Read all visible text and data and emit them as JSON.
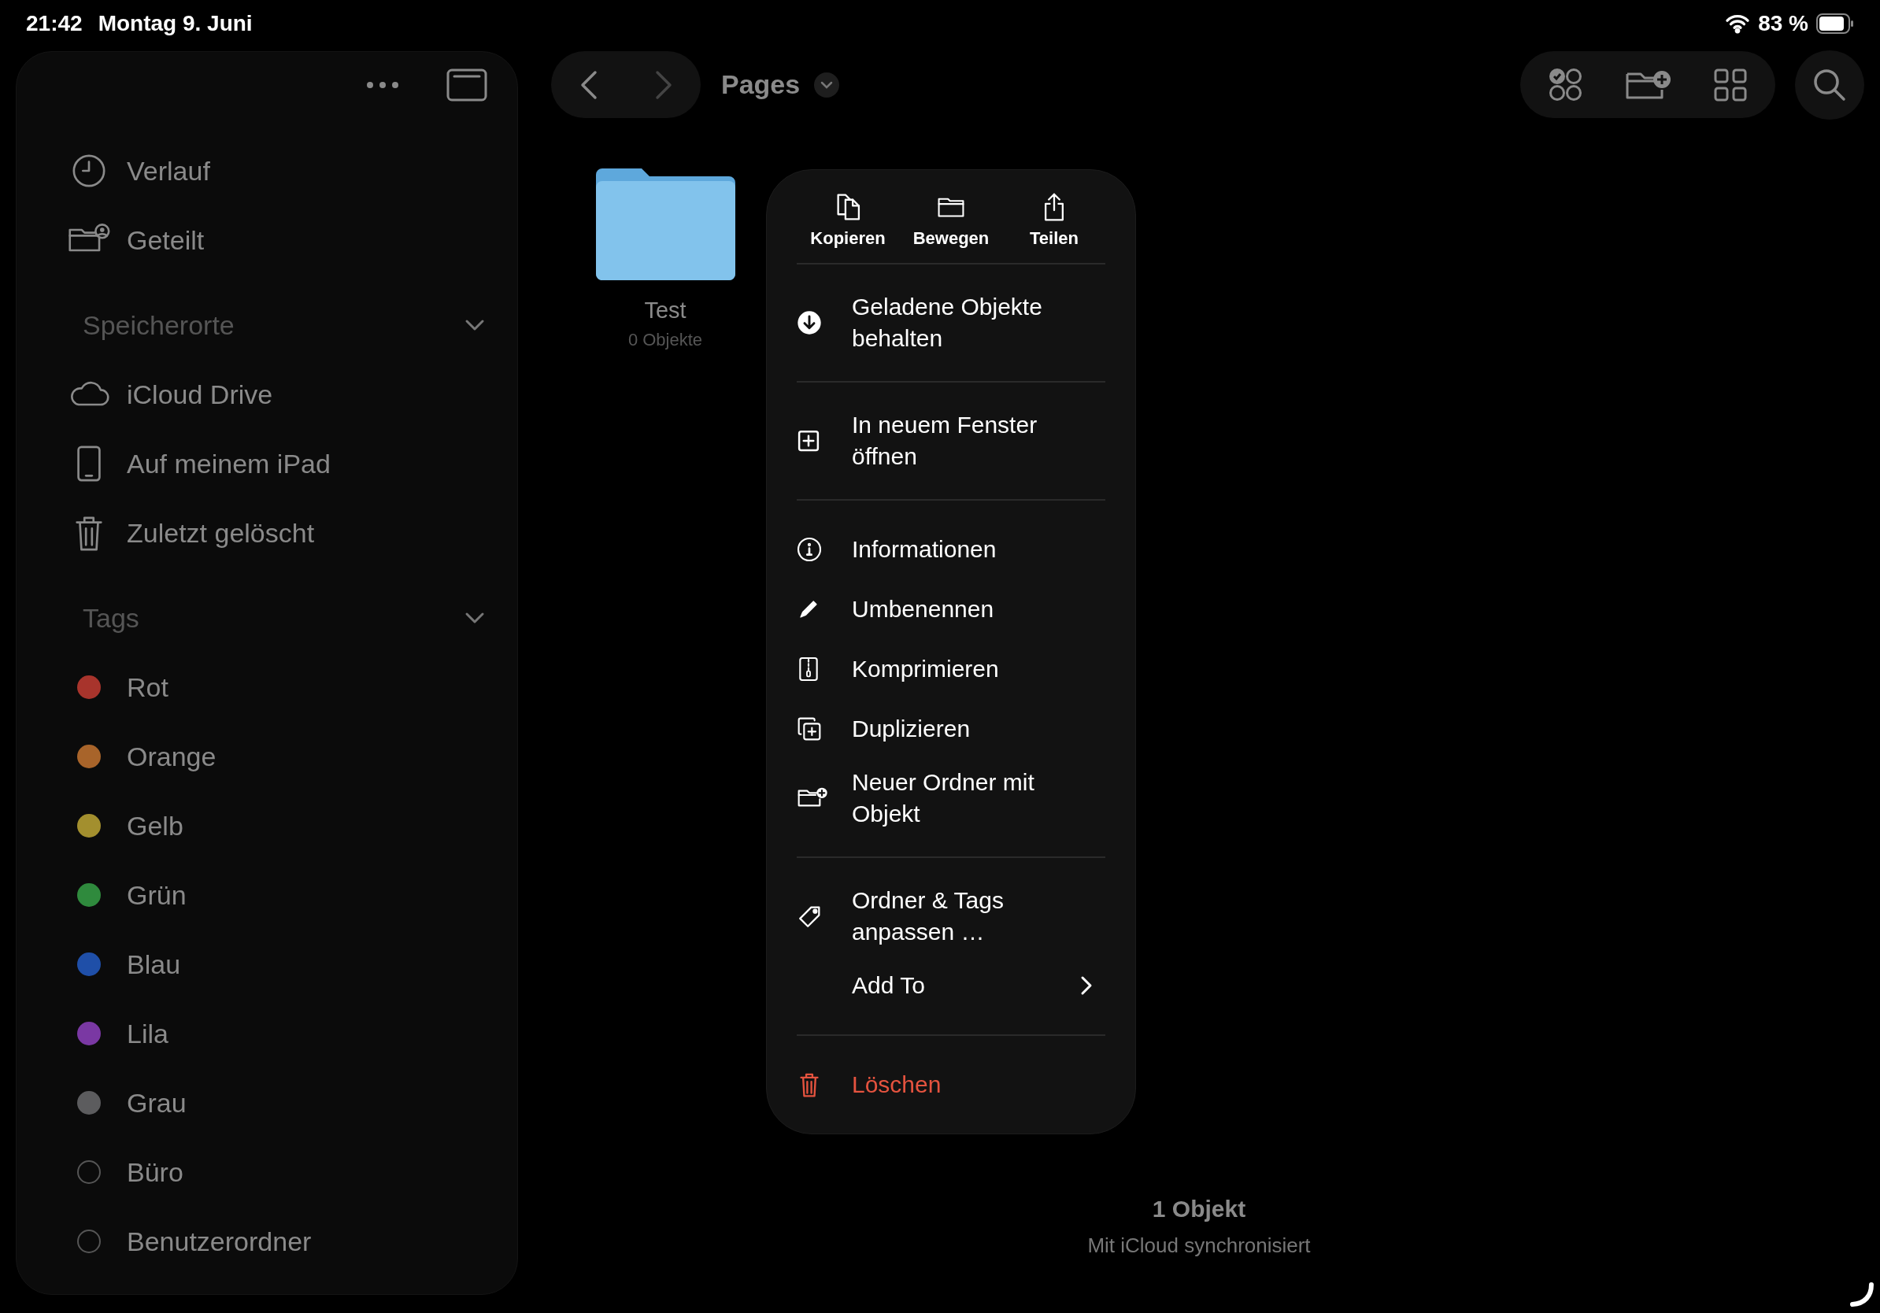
{
  "status_bar": {
    "time": "21:42",
    "date": "Montag 9. Juni",
    "battery": "83 %"
  },
  "sidebar": {
    "items": [
      {
        "label": "Verlauf",
        "kind": "clock"
      },
      {
        "label": "Geteilt",
        "kind": "shared"
      }
    ],
    "sections": [
      {
        "title": "Speicherorte",
        "expanded": true,
        "items": [
          {
            "label": "iCloud Drive",
            "kind": "cloud"
          },
          {
            "label": "Auf meinem iPad",
            "kind": "ipad"
          },
          {
            "label": "Zuletzt gelöscht",
            "kind": "trash"
          }
        ]
      },
      {
        "title": "Tags",
        "expanded": true,
        "items": [
          {
            "label": "Rot",
            "kind": "tag",
            "color": "#a8342c"
          },
          {
            "label": "Orange",
            "kind": "tag",
            "color": "#a8642a"
          },
          {
            "label": "Gelb",
            "kind": "tag",
            "color": "#a38f2e"
          },
          {
            "label": "Grün",
            "kind": "tag",
            "color": "#2f8a3d"
          },
          {
            "label": "Blau",
            "kind": "tag",
            "color": "#1f4fa8"
          },
          {
            "label": "Lila",
            "kind": "tag",
            "color": "#7a38a3"
          },
          {
            "label": "Grau",
            "kind": "tag",
            "color": "#5c5c5e"
          },
          {
            "label": "Büro",
            "kind": "outline"
          },
          {
            "label": "Benutzerordner",
            "kind": "outline"
          }
        ]
      }
    ]
  },
  "toolbar": {
    "location": "Pages"
  },
  "files": [
    {
      "name": "Test",
      "subtitle": "0 Objekte"
    }
  ],
  "context_menu": {
    "actions": [
      {
        "label": "Kopieren",
        "kind": "copy"
      },
      {
        "label": "Bewegen",
        "kind": "folder"
      },
      {
        "label": "Teilen",
        "kind": "share"
      }
    ],
    "groups": [
      [
        {
          "label": "Geladene Objekte behalten",
          "kind": "download"
        }
      ],
      [
        {
          "label": "In neuem Fenster öffnen",
          "kind": "window"
        }
      ],
      [
        {
          "label": "Informationen",
          "kind": "info"
        },
        {
          "label": "Umbenennen",
          "kind": "pencil"
        },
        {
          "label": "Komprimieren",
          "kind": "zip"
        },
        {
          "label": "Duplizieren",
          "kind": "duplicate"
        },
        {
          "label": "Neuer Ordner mit Objekt",
          "kind": "new-folder"
        }
      ],
      [
        {
          "label": "Ordner & Tags anpassen …",
          "kind": "tag"
        },
        {
          "label": "Add To",
          "kind": "plain",
          "submenu": true
        }
      ],
      [
        {
          "label": "Löschen",
          "kind": "trash",
          "destructive": true
        }
      ]
    ]
  },
  "footer": {
    "count": "1 Objekt",
    "sync": "Mit iCloud synchronisiert"
  }
}
